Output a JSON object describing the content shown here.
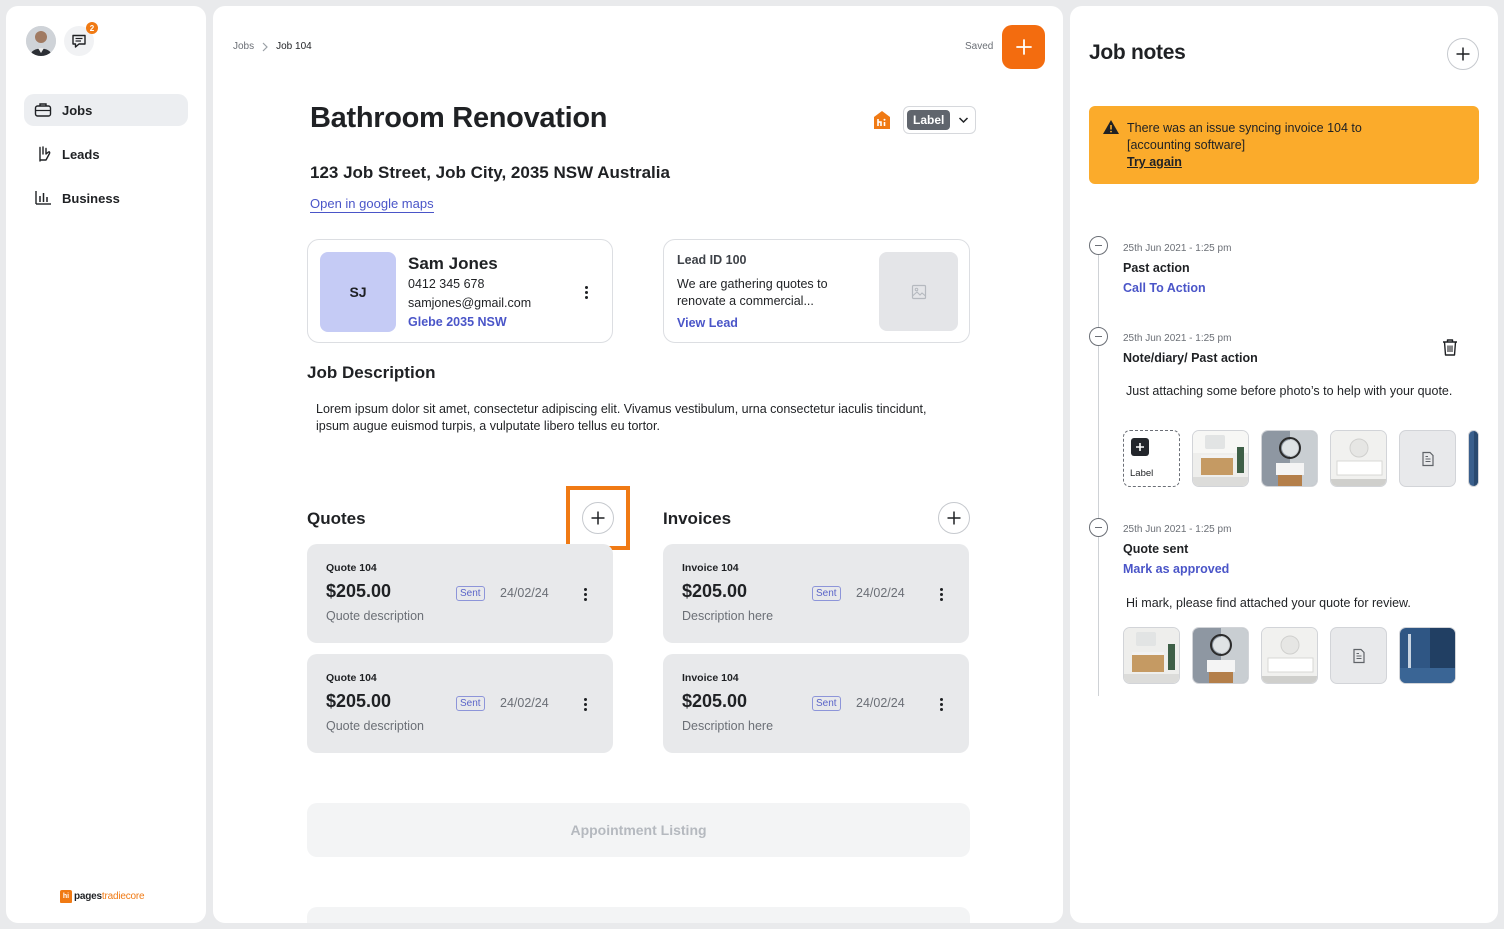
{
  "sidebar": {
    "notification_count": "2",
    "items": [
      {
        "label": "Jobs",
        "icon": "briefcase-icon",
        "active": true
      },
      {
        "label": "Leads",
        "icon": "hand-icon",
        "active": false
      },
      {
        "label": "Business",
        "icon": "bar-chart-icon",
        "active": false
      }
    ],
    "brand": {
      "part1": "pages",
      "part2": "tradiecore",
      "mark": "hi"
    }
  },
  "main": {
    "breadcrumb": [
      "Jobs",
      "Job 104"
    ],
    "save_status": "Saved",
    "title": "Bathroom Renovation",
    "label_tag": "Label",
    "address": "123 Job Street, Job City, 2035 NSW Australia",
    "maps_link": "Open in google maps",
    "contact": {
      "initials": "SJ",
      "name": "Sam Jones",
      "phone": "0412 345 678",
      "email": "samjones@gmail.com",
      "location": "Glebe 2035 NSW"
    },
    "lead": {
      "id": "Lead ID 100",
      "description": "We are gathering quotes to renovate a commercial...",
      "link": "View Lead"
    },
    "job_description_heading": "Job Description",
    "job_description": "Lorem ipsum dolor sit amet, consectetur adipiscing elit. Vivamus vestibulum, urna consectetur iaculis tincidunt, ipsum augue euismod turpis, a vulputate libero tellus eu tortor.",
    "quotes": {
      "heading": "Quotes",
      "items": [
        {
          "title": "Quote 104",
          "amount": "$205.00",
          "status": "Sent",
          "date": "24/02/24",
          "description": "Quote description"
        },
        {
          "title": "Quote 104",
          "amount": "$205.00",
          "status": "Sent",
          "date": "24/02/24",
          "description": "Quote description"
        }
      ]
    },
    "invoices": {
      "heading": "Invoices",
      "items": [
        {
          "title": "Invoice 104",
          "amount": "$205.00",
          "status": "Sent",
          "date": "24/02/24",
          "description": "Description here"
        },
        {
          "title": "Invoice 104",
          "amount": "$205.00",
          "status": "Sent",
          "date": "24/02/24",
          "description": "Description here"
        }
      ]
    },
    "appointment_listing": "Appointment Listing"
  },
  "notes": {
    "title": "Job notes",
    "alert": {
      "text": "There was an issue syncing invoice 104 to [accounting software]",
      "action": "Try again"
    },
    "timeline": [
      {
        "date": "25th Jun 2021 - 1:25 pm",
        "heading": "Past action",
        "link": "Call To  Action"
      },
      {
        "date": "25th Jun 2021 - 1:25 pm",
        "heading": "Note/diary/ Past action",
        "body": "Just attaching some before photo’s to help with your quote.",
        "add_label": "Label"
      },
      {
        "date": "25th Jun 2021 - 1:25 pm",
        "heading": "Quote sent",
        "link": "Mark as approved",
        "body": "Hi mark, please find attached your quote for review."
      }
    ]
  },
  "colors": {
    "accent": "#f36c0f",
    "link": "#4a55c8",
    "alert": "#fbab2b"
  }
}
